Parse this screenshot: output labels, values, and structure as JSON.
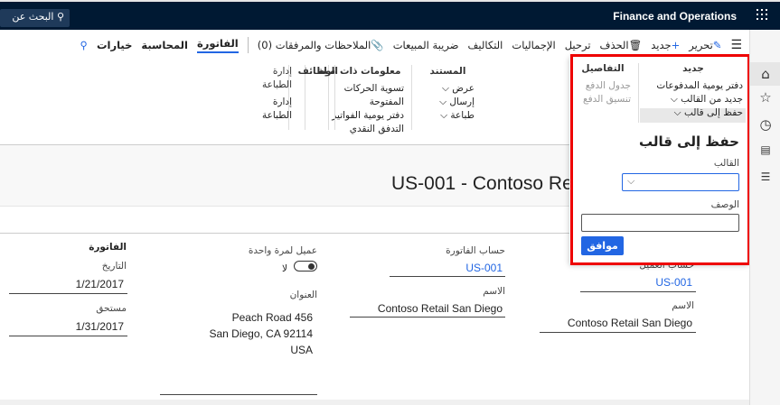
{
  "topbar": {
    "app_title": "Finance and Operations",
    "search_label": "البحث عن"
  },
  "actions": {
    "edit": "تحرير",
    "new": "جديد",
    "delete": "الحذف",
    "post": "ترحيل",
    "totals": "الإجماليات",
    "charges": "التكاليف",
    "sales_tax": "ضريبة المبيعات",
    "notes": "الملاحظات والمرفقات (0)",
    "invoice": "الفاتورة",
    "accounting": "المحاسبة",
    "options": "خيارات"
  },
  "ribbon": {
    "new": {
      "title": "جديد",
      "items": [
        "دفتر يومية المدفوعات",
        "جديد من القالب",
        "حفظ إلى قالب"
      ]
    },
    "details": {
      "title": "التفاصيل",
      "items": [
        "جدول الدفع",
        "تنسيق الدفع"
      ]
    },
    "related": {
      "title": "معلومات ذات صلة",
      "items": [
        "تسوية الحركات المفتوحة",
        "دفتر يومية الفواتير",
        "التدفق النقدي"
      ]
    },
    "document": {
      "title": "المستند",
      "items": [
        "عرض",
        "إرسال",
        "طباعة"
      ]
    },
    "functions": {
      "title": "الوظائف"
    },
    "print_mgmt": {
      "title": "إدارة الطباعة",
      "items": [
        "إدارة الطباعة"
      ]
    }
  },
  "flyout": {
    "title": "حفظ إلى قالب",
    "template_label": "القالب",
    "template_value": "",
    "description_label": "الوصف",
    "description_value": "",
    "ok": "موافق"
  },
  "page": {
    "title": "US-001 - Contoso Re"
  },
  "form": {
    "customer_account_label": "حساب العميل",
    "customer_account": "US-001",
    "customer_name_label": "الاسم",
    "customer_name": "Contoso Retail San Diego",
    "invoice_account_label": "حساب الفاتورة",
    "invoice_account": "US-001",
    "invoice_name_label": "الاسم",
    "invoice_name": "Contoso Retail San Diego",
    "one_time_label": "عميل لمرة واحدة",
    "one_time_value": "لا",
    "address_label": "العنوان",
    "address_lines": [
      "Peach Road 456",
      "San Diego, CA 92114",
      "USA"
    ],
    "invoice_section": "الفاتورة",
    "date_label": "التاريخ",
    "date": "1/21/2017",
    "due_label": "مستحق",
    "due": "1/31/2017"
  }
}
